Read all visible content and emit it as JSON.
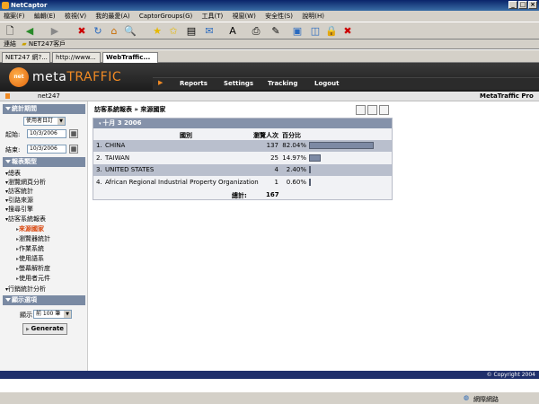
{
  "window": {
    "title": "NetCaptor"
  },
  "menu": [
    "檔案(F)",
    "編輯(E)",
    "檢視(V)",
    "我的最愛(A)",
    "CaptorGroups(G)",
    "工具(T)",
    "視窗(W)",
    "安全性(S)",
    "說明(H)"
  ],
  "addressbar": {
    "label": "連結",
    "folder": "NET247客戶"
  },
  "tabs": [
    "NET247 網?...",
    "http://www...",
    "WebTraffic..."
  ],
  "app": {
    "logo_mark": "net",
    "logo_meta": "meta",
    "logo_traffic": "TRAFFIC",
    "nav": [
      "Reports",
      "Settings",
      "Tracking",
      "Logout"
    ],
    "site": "net247",
    "product": "MetaTraffic Pro",
    "copyright": "© Copyright 2004"
  },
  "sidebar": {
    "stats_title": "統計期間",
    "period_select": "使用者日訂",
    "start_label": "起始:",
    "start_date": "10/3/2006",
    "end_label": "結束:",
    "end_date": "10/3/2006",
    "report_type_title": "報表類型",
    "items": [
      {
        "label": "總表",
        "kind": "top"
      },
      {
        "label": "瀏覽網頁分析",
        "kind": "top"
      },
      {
        "label": "訪客統計",
        "kind": "top"
      },
      {
        "label": "引路來源",
        "kind": "top"
      },
      {
        "label": "搜尋引擎",
        "kind": "top"
      },
      {
        "label": "訪客系統報表",
        "kind": "top"
      },
      {
        "label": "來源國家",
        "kind": "sub-current"
      },
      {
        "label": "瀏覽器統計",
        "kind": "sub"
      },
      {
        "label": "作業系統",
        "kind": "sub"
      },
      {
        "label": "使用語系",
        "kind": "sub"
      },
      {
        "label": "螢幕解析度",
        "kind": "sub"
      },
      {
        "label": "使用者元件",
        "kind": "sub"
      },
      {
        "label": "行銷統計分析",
        "kind": "top"
      }
    ],
    "display_title": "顯示選項",
    "display_label": "顯示",
    "display_select": "前 100 筆",
    "generate": "Generate"
  },
  "report": {
    "title": "訪客系統報表 » 來源國家",
    "date": "十月 3 2006",
    "col_country": "國別",
    "col_visits": "瀏覽人次",
    "col_pct": "百分比",
    "rows": [
      {
        "num": "1.",
        "country": "CHINA",
        "visits": "137",
        "pct": "82.04%",
        "share": 0.8204
      },
      {
        "num": "2.",
        "country": "TAIWAN",
        "visits": "25",
        "pct": "14.97%",
        "share": 0.1497
      },
      {
        "num": "3.",
        "country": "UNITED STATES",
        "visits": "4",
        "pct": "2.40%",
        "share": 0.024
      },
      {
        "num": "4.",
        "country": "African Regional Industrial Property Organization",
        "visits": "1",
        "pct": "0.60%",
        "share": 0.006
      }
    ],
    "total_label": "總計:",
    "total": "167"
  },
  "status": {
    "zone": "網際網路"
  }
}
